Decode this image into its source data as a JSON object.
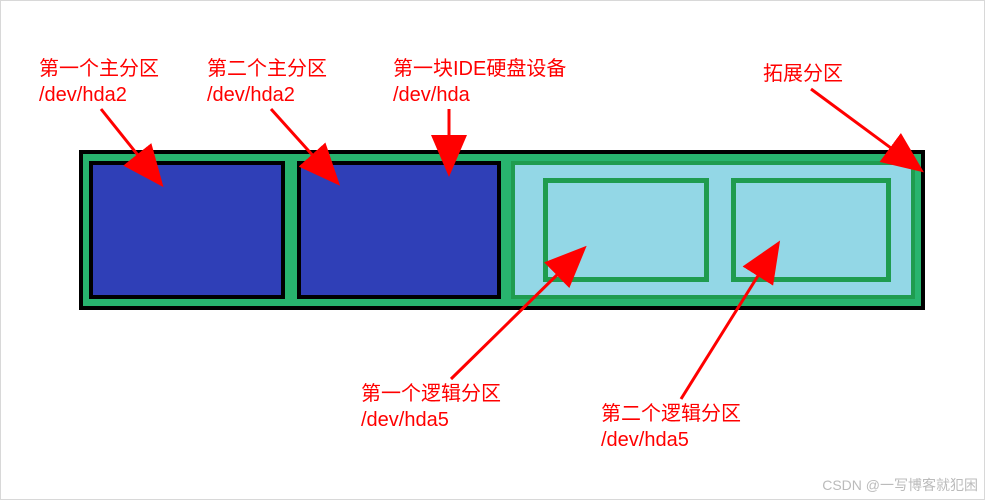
{
  "labels": {
    "primary1": {
      "title": "第一个主分区",
      "path": "/dev/hda2"
    },
    "primary2": {
      "title": "第二个主分区",
      "path": "/dev/hda2"
    },
    "disk": {
      "title": "第一块IDE硬盘设备",
      "path": "/dev/hda"
    },
    "extended": {
      "title": "拓展分区",
      "path": ""
    },
    "logical1": {
      "title": "第一个逻辑分区",
      "path": "/dev/hda5"
    },
    "logical2": {
      "title": "第二个逻辑分区",
      "path": "/dev/hda5"
    }
  },
  "colors": {
    "arrow": "#ff0000",
    "label": "#ff0000",
    "disk_border": "#000000",
    "primary_fill": "#2f3fb7",
    "extended_border": "#1f9c4f",
    "extended_fill": "#93d7e6",
    "background_green": "#28b46e"
  },
  "watermark": "CSDN @一写博客就犯困"
}
